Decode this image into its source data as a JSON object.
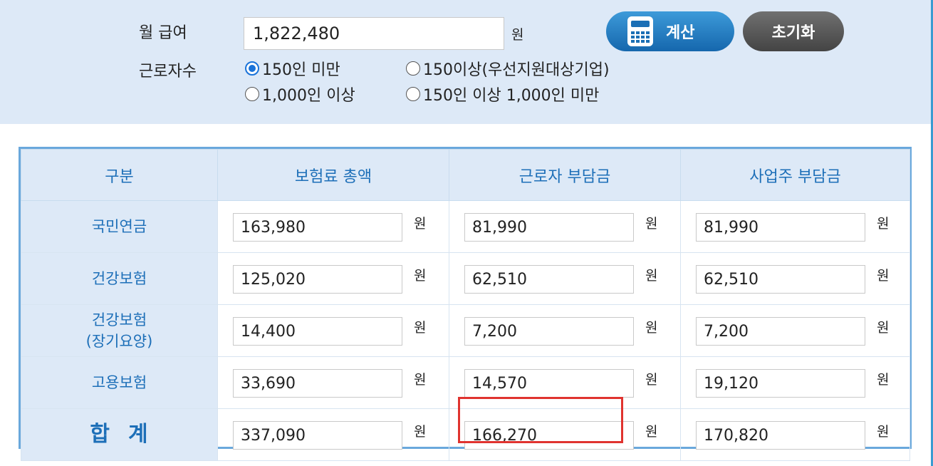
{
  "form": {
    "salary_label": "월 급여",
    "salary_value": "1,822,480",
    "salary_unit": "원",
    "calc_button": "계산",
    "reset_button": "초기화",
    "workers_label": "근로자수",
    "options": [
      {
        "label": "150인 미만",
        "checked": true
      },
      {
        "label": "150이상(우선지원대상기업)",
        "checked": false
      },
      {
        "label": "1,000인 이상",
        "checked": false
      },
      {
        "label": "150인 이상 1,000인 미만",
        "checked": false
      }
    ]
  },
  "table": {
    "headers": [
      "구분",
      "보험료 총액",
      "근로자 부담금",
      "사업주 부담금"
    ],
    "unit": "원",
    "rows": [
      {
        "name": "국민연금",
        "name2": "",
        "total": "163,980",
        "employee": "81,990",
        "employer": "81,990"
      },
      {
        "name": "건강보험",
        "name2": "",
        "total": "125,020",
        "employee": "62,510",
        "employer": "62,510"
      },
      {
        "name": "건강보험",
        "name2": "(장기요양)",
        "total": "14,400",
        "employee": "7,200",
        "employer": "7,200"
      },
      {
        "name": "고용보험",
        "name2": "",
        "total": "33,690",
        "employee": "14,570",
        "employer": "19,120"
      },
      {
        "name": "합계",
        "name2": "",
        "total": "337,090",
        "employee": "166,270",
        "employer": "170,820"
      }
    ]
  },
  "colors": {
    "accent": "#1d6fb8",
    "panel_bg": "#dde9f7",
    "highlight": "#e0332f"
  }
}
